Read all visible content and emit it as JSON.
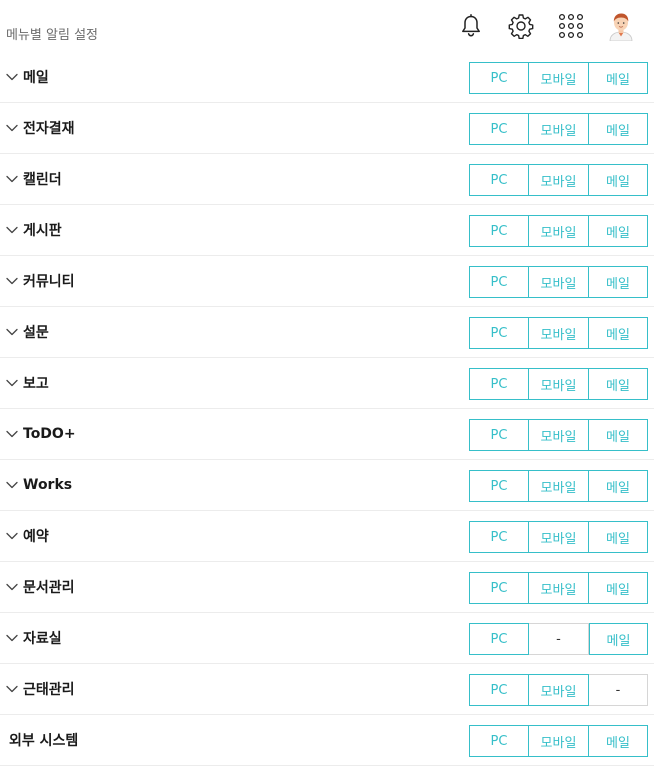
{
  "header": {
    "title": "메뉴별 알림 설정",
    "icons": [
      "bell-icon",
      "gear-icon",
      "apps-grid-icon",
      "avatar"
    ]
  },
  "colors": {
    "accent": "#36bfc9",
    "divider": "#ececec"
  },
  "rows": [
    {
      "label": "메일",
      "pc": "PC",
      "mobile": "모바일",
      "mail": "메일",
      "chevron": true
    },
    {
      "label": "전자결재",
      "pc": "PC",
      "mobile": "모바일",
      "mail": "메일",
      "chevron": true
    },
    {
      "label": "캘린더",
      "pc": "PC",
      "mobile": "모바일",
      "mail": "메일",
      "chevron": true
    },
    {
      "label": "게시판",
      "pc": "PC",
      "mobile": "모바일",
      "mail": "메일",
      "chevron": true
    },
    {
      "label": "커뮤니티",
      "pc": "PC",
      "mobile": "모바일",
      "mail": "메일",
      "chevron": true
    },
    {
      "label": "설문",
      "pc": "PC",
      "mobile": "모바일",
      "mail": "메일",
      "chevron": true
    },
    {
      "label": "보고",
      "pc": "PC",
      "mobile": "모바일",
      "mail": "메일",
      "chevron": true
    },
    {
      "label": "ToDO+",
      "pc": "PC",
      "mobile": "모바일",
      "mail": "메일",
      "chevron": true
    },
    {
      "label": "Works",
      "pc": "PC",
      "mobile": "모바일",
      "mail": "메일",
      "chevron": true
    },
    {
      "label": "예약",
      "pc": "PC",
      "mobile": "모바일",
      "mail": "메일",
      "chevron": true
    },
    {
      "label": "문서관리",
      "pc": "PC",
      "mobile": "모바일",
      "mail": "메일",
      "chevron": true
    },
    {
      "label": "자료실",
      "pc": "PC",
      "mobile": "-",
      "mail": "메일",
      "chevron": true
    },
    {
      "label": "근태관리",
      "pc": "PC",
      "mobile": "모바일",
      "mail": "-",
      "chevron": true
    },
    {
      "label": "외부 시스템",
      "pc": "PC",
      "mobile": "모바일",
      "mail": "메일",
      "chevron": false
    }
  ]
}
